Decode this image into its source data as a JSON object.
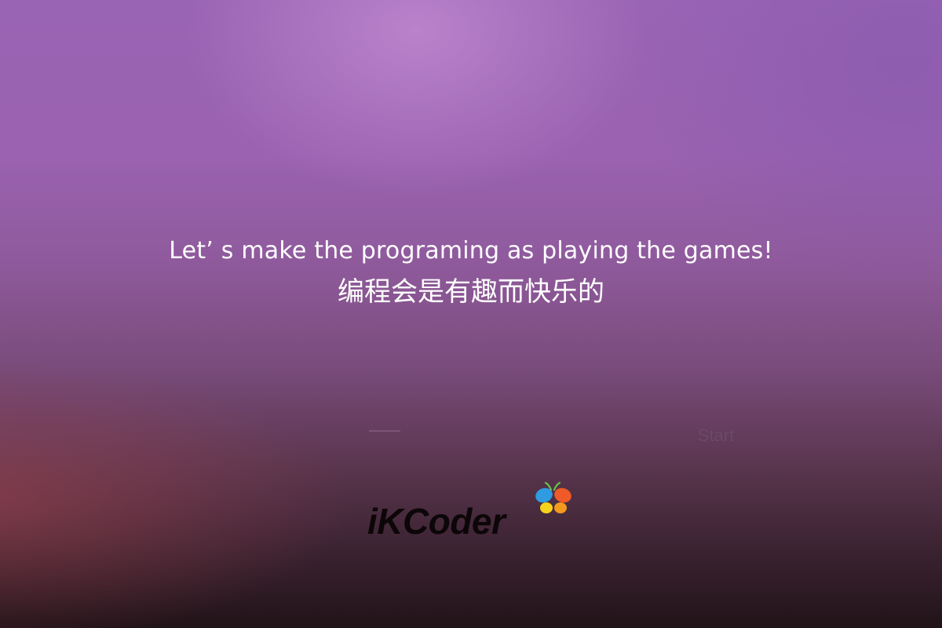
{
  "hero": {
    "tagline_en": "Let’  s make the programing as playing the games!",
    "tagline_zh": "编程会是有趣而快乐的"
  },
  "actions": {
    "start_label": "Start"
  },
  "brand": {
    "logo_text": "iKCoder",
    "icon": "butterfly-icon",
    "colors": {
      "wing_top_left": "#2f9be0",
      "wing_top_right": "#f05a28",
      "wing_bottom_left": "#f6d21a",
      "wing_bottom_right": "#f39a1e",
      "antenna": "#6cc04a"
    }
  }
}
